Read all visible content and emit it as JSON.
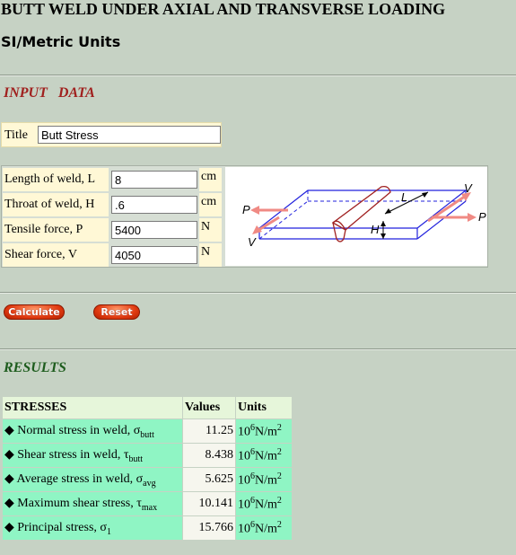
{
  "header": {
    "title": "BUTT WELD UNDER AXIAL AND TRANSVERSE LOADING",
    "subtitle": "SI/Metric Units"
  },
  "input": {
    "section_label": "INPUT   DATA",
    "title_label": "Title",
    "title_value": "Butt Stress",
    "fields": [
      {
        "label": "Length of weld, L",
        "value": "8",
        "unit": "cm"
      },
      {
        "label": "Throat of weld, H",
        "value": ".6",
        "unit": "cm"
      },
      {
        "label": "Tensile force, P",
        "value": "5400",
        "unit": "N"
      },
      {
        "label": "Shear force, V",
        "value": "4050",
        "unit": "N"
      }
    ]
  },
  "buttons": {
    "calculate": "Calculate",
    "reset": "Reset"
  },
  "results": {
    "section_label": "RESULTS",
    "headers": [
      "STRESSES",
      "Values",
      "Units"
    ],
    "rows": [
      {
        "name": "◆ Normal stress in weld, σ",
        "sub": "butt",
        "value": "11.25"
      },
      {
        "name": "◆ Shear stress in weld, τ",
        "sub": "butt",
        "value": "8.438"
      },
      {
        "name": "◆ Average stress in weld, σ",
        "sub": "avg",
        "value": "5.625"
      },
      {
        "name": "◆ Maximum shear stress, τ",
        "sub": "max",
        "value": "10.141"
      },
      {
        "name": "◆ Principal stress, σ",
        "sub": "1",
        "value": "15.766"
      }
    ],
    "unit_base": "10",
    "unit_exp": "6",
    "unit_mid": "N/m",
    "unit_exp2": "2"
  },
  "diagram_labels": {
    "p": "P",
    "v": "V",
    "l": "L",
    "h": "H"
  },
  "colors": {
    "background": "#c6d2c4",
    "input_label_bg": "#fff8d6",
    "result_row_bg": "#8ff5c4",
    "input_heading": "#a0201e",
    "results_heading": "#1d5c1d",
    "button": "#e03a10"
  }
}
